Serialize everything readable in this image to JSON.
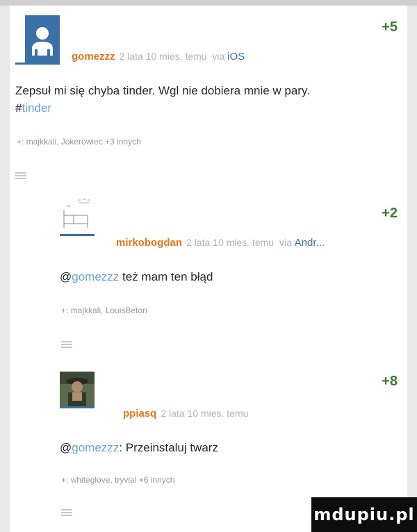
{
  "posts": [
    {
      "score": "+5",
      "username": "gomezzz",
      "time": "2 lata 10 mies. temu",
      "via": "via",
      "client": "iOS",
      "text_line1": "Zepsuł mi się chyba tinder. Wgl nie dobiera mnie w pary.",
      "hashtag_prefix": "#",
      "hashtag": "tinder",
      "plus_prefix": "+:",
      "plus_users": "majkkali, Jokerowiec +3 innych"
    },
    {
      "score": "+2",
      "username": "mirkobogdan",
      "time": "2 lata 10 mies. temu",
      "via": "via",
      "client": "Andr...",
      "mention_prefix": "@",
      "mention": "gomezzz",
      "text": " też mam ten błąd",
      "plus_prefix": "+:",
      "plus_users": "majkkali, LouisBeton"
    },
    {
      "score": "+8",
      "username": "ppiasq",
      "time": "2 lata 10 mies. temu",
      "mention_prefix": "@",
      "mention": "gomezzz",
      "text": ": Przeinstaluj twarz",
      "plus_prefix": "+:",
      "plus_users": "whiteglove, tryvial +6 innych"
    }
  ],
  "watermark": "mdupiu.pl",
  "colors": {
    "username": "#e2761a",
    "score": "#3d7a36",
    "link": "#6aa2cf",
    "client": "#3b6ea5"
  }
}
